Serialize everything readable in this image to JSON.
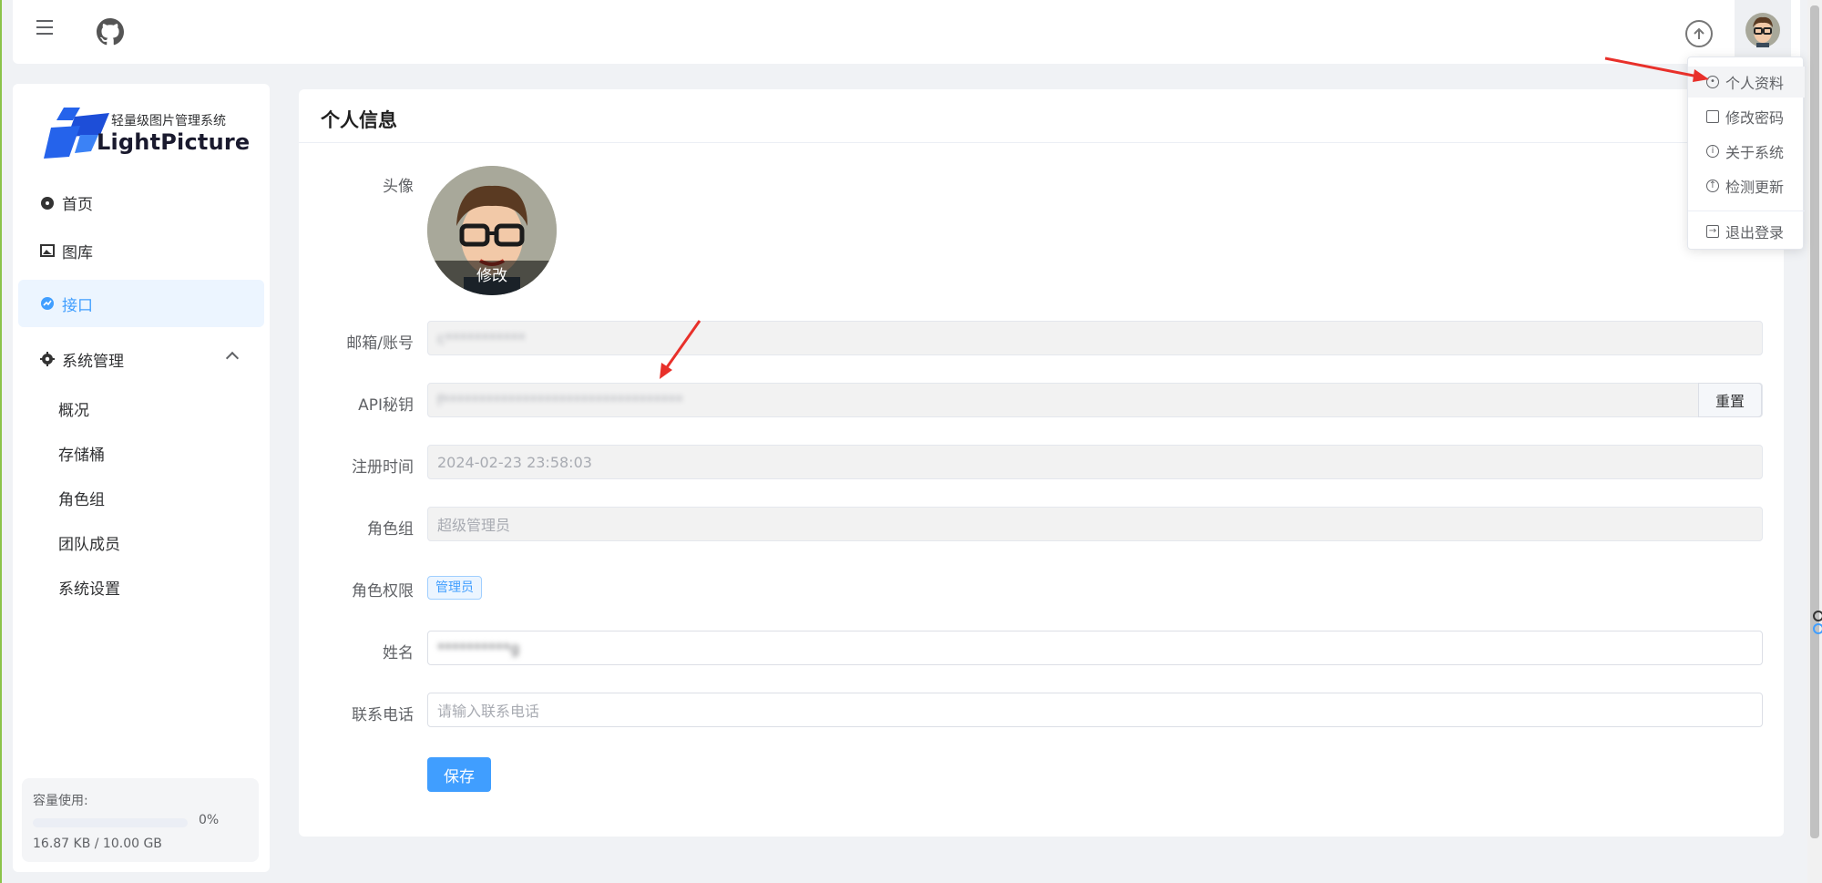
{
  "header": {
    "menu_icon": "hamburger-icon",
    "github_icon": "github-icon",
    "upload_icon": "upload-circle-icon",
    "avatar_icon": "user-avatar-icon"
  },
  "dropdown": {
    "items": [
      {
        "label": "个人资料",
        "icon": "user-circle-icon"
      },
      {
        "label": "修改密码",
        "icon": "lock-icon"
      },
      {
        "label": "关于系统",
        "icon": "info-circle-icon"
      },
      {
        "label": "检测更新",
        "icon": "upload-circle-icon"
      },
      {
        "label": "退出登录",
        "icon": "logout-icon"
      }
    ]
  },
  "sidebar": {
    "logo_subtitle": "轻量级图片管理系统",
    "logo_name": "LightPicture",
    "nav": [
      {
        "label": "首页",
        "icon": "dashboard-icon"
      },
      {
        "label": "图库",
        "icon": "image-icon"
      },
      {
        "label": "接口",
        "icon": "api-icon"
      },
      {
        "label": "系统管理",
        "icon": "gear-icon"
      }
    ],
    "sub_nav": [
      "概况",
      "存储桶",
      "角色组",
      "团队成员",
      "系统设置"
    ],
    "usage": {
      "label": "容量使用:",
      "percent_text": "0%",
      "percent": 0,
      "size_text": "16.87 KB / 10.00 GB"
    }
  },
  "main": {
    "title": "个人信息",
    "avatar_label": "头像",
    "avatar_edit": "修改",
    "email_label": "邮箱/账号",
    "email_value": "c***********",
    "api_label": "API秘钥",
    "api_value": "f*********************************",
    "reset_label": "重置",
    "reg_label": "注册时间",
    "reg_value": "2024-02-23 23:58:03",
    "role_label": "角色组",
    "role_value": "超级管理员",
    "perm_label": "角色权限",
    "perm_tag": "管理员",
    "name_label": "姓名",
    "name_value": "**********g",
    "phone_label": "联系电话",
    "phone_placeholder": "请输入联系电话",
    "save_label": "保存"
  },
  "colors": {
    "accent": "#409eff",
    "arrow": "#e8302a"
  }
}
